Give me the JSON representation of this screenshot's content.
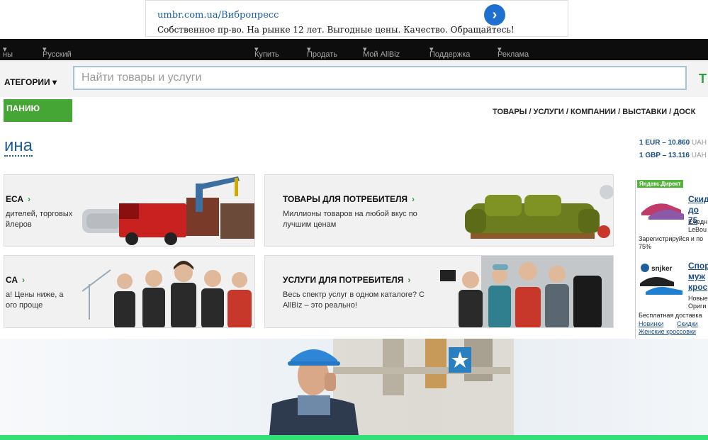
{
  "ad": {
    "url": "umbr.com.ua/Вибропресс",
    "text": "Собственное пр-во. На рынке 12 лет. Выгодные цены. Качество. Обращайтесь!"
  },
  "topnav": {
    "left_items": [
      "ны",
      "Русский"
    ],
    "right_items": [
      "Купить",
      "Продать",
      "Мой AllBiz",
      "Поддержка",
      "Реклама"
    ]
  },
  "search": {
    "category_label": "АТЕГОРИИ",
    "placeholder": "Найти товары и услуги",
    "right_letter": "Т"
  },
  "green_button": "ПАНИЮ",
  "main_links": "ТОВАРЫ / УСЛУГИ / КОМПАНИИ / ВЫСТАВКИ / ДОСК",
  "page_title": "ина",
  "cards": [
    {
      "title": "ЕСА",
      "desc": "дителей, торговых\nйлеров"
    },
    {
      "title": "ТОВАРЫ ДЛЯ ПОТРЕБИТЕЛЯ",
      "desc": "Миллионы товаров на любой вкус по\nлучшим ценам"
    },
    {
      "title": "СА",
      "desc": "а! Цены ниже, а\nого проще"
    },
    {
      "title": "УСЛУГИ ДЛЯ ПОТРЕБИТЕЛЯ",
      "desc": "Весь спектр услуг в одном каталоге? С\nAllBiz – это реально!"
    }
  ],
  "currency": {
    "eur": "1 EUR – 10.860",
    "gbp": "1 GBP – 13.116",
    "unit": "UAH"
  },
  "yandex": {
    "badge": "Яндекс.Директ",
    "ad1": {
      "title": "Скид до 75",
      "line1": "Ежедн",
      "line2": "LeBou",
      "line3": "Зарегистрируйся и по",
      "line4": "75%"
    },
    "ad2": {
      "brand": "snjker",
      "title": "Спор муж крос",
      "line1": "Новые",
      "line2": "Ориги",
      "line3": "Бесплатная доставка",
      "link1": "Новинки",
      "link2": "Скидки",
      "link3": "Женские кроссовки"
    }
  },
  "colors": {
    "nav_bg": "#0d0d0d",
    "accent_green": "#45a535",
    "link_blue": "#1c5b9c",
    "bottom_bar": "#33e078"
  }
}
